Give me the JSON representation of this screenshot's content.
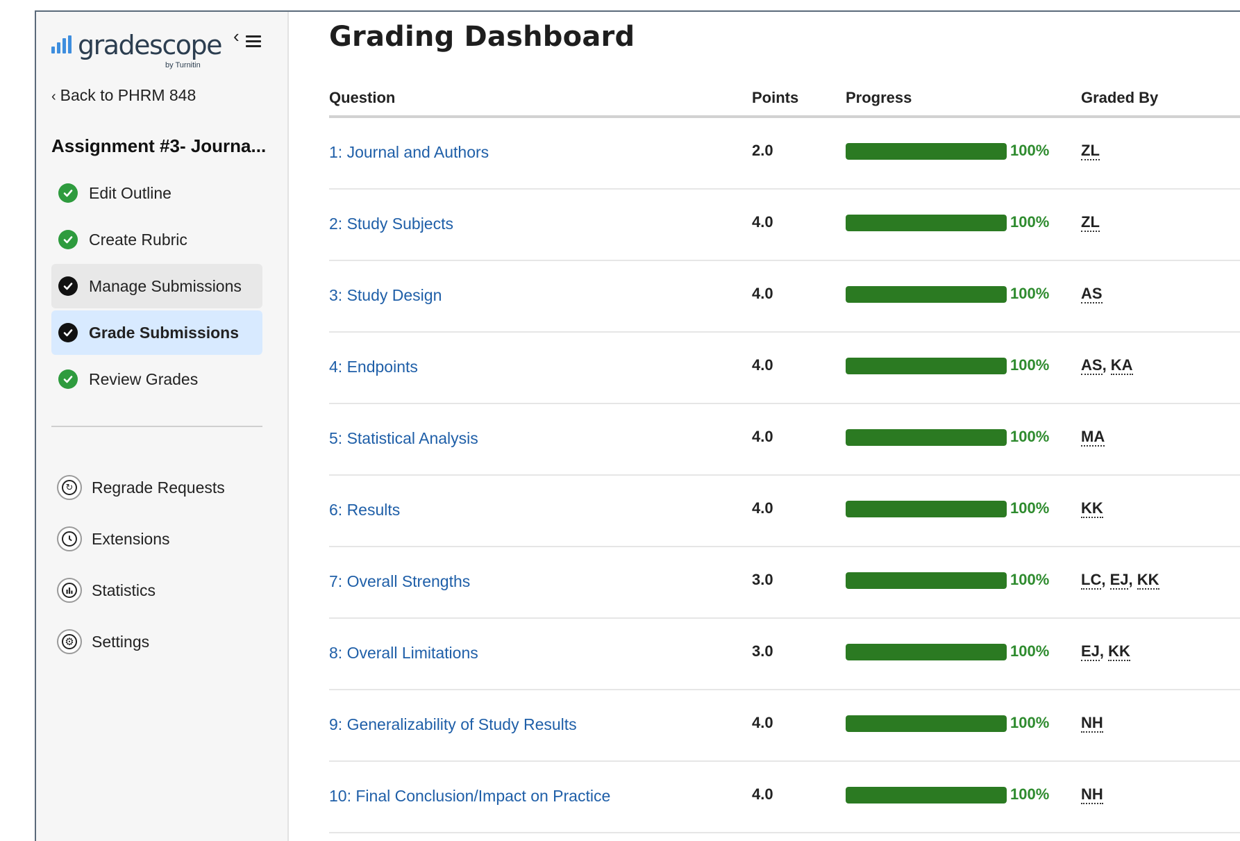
{
  "brand": {
    "name": "gradescope",
    "byline": "by Turnitin",
    "accent_color": "#3e8ede"
  },
  "sidebar": {
    "back_label": "Back to PHRM 848",
    "assignment_title": "Assignment #3- Journa...",
    "workflow": [
      {
        "label": "Edit Outline",
        "status": "complete",
        "icon": "check-circle-green-icon"
      },
      {
        "label": "Create Rubric",
        "status": "complete",
        "icon": "check-circle-green-icon"
      },
      {
        "label": "Manage Submissions",
        "status": "complete",
        "icon": "check-circle-black-icon"
      },
      {
        "label": "Grade Submissions",
        "status": "active",
        "icon": "check-circle-black-icon"
      },
      {
        "label": "Review Grades",
        "status": "complete",
        "icon": "check-circle-green-icon"
      }
    ],
    "tools": [
      {
        "label": "Regrade Requests",
        "icon": "regrade-icon"
      },
      {
        "label": "Extensions",
        "icon": "clock-icon"
      },
      {
        "label": "Statistics",
        "icon": "bar-chart-icon"
      },
      {
        "label": "Settings",
        "icon": "gear-icon"
      }
    ]
  },
  "main": {
    "title": "Grading Dashboard",
    "columns": {
      "question": "Question",
      "points": "Points",
      "progress": "Progress",
      "graded_by": "Graded By"
    },
    "progress_color": "#2b7a22",
    "rows": [
      {
        "question": "1: Journal and Authors",
        "points": "2.0",
        "progress": 100,
        "progress_label": "100%",
        "graders": [
          "ZL"
        ]
      },
      {
        "question": "2: Study Subjects",
        "points": "4.0",
        "progress": 100,
        "progress_label": "100%",
        "graders": [
          "ZL"
        ]
      },
      {
        "question": "3: Study Design",
        "points": "4.0",
        "progress": 100,
        "progress_label": "100%",
        "graders": [
          "AS"
        ]
      },
      {
        "question": "4: Endpoints",
        "points": "4.0",
        "progress": 100,
        "progress_label": "100%",
        "graders": [
          "AS",
          "KA"
        ]
      },
      {
        "question": "5: Statistical Analysis",
        "points": "4.0",
        "progress": 100,
        "progress_label": "100%",
        "graders": [
          "MA"
        ]
      },
      {
        "question": "6: Results",
        "points": "4.0",
        "progress": 100,
        "progress_label": "100%",
        "graders": [
          "KK"
        ]
      },
      {
        "question": "7: Overall Strengths",
        "points": "3.0",
        "progress": 100,
        "progress_label": "100%",
        "graders": [
          "LC",
          "EJ",
          "KK"
        ]
      },
      {
        "question": "8: Overall Limitations",
        "points": "3.0",
        "progress": 100,
        "progress_label": "100%",
        "graders": [
          "EJ",
          "KK"
        ]
      },
      {
        "question": "9: Generalizability of Study Results",
        "points": "4.0",
        "progress": 100,
        "progress_label": "100%",
        "graders": [
          "NH"
        ]
      },
      {
        "question": "10: Final Conclusion/Impact on Practice",
        "points": "4.0",
        "progress": 100,
        "progress_label": "100%",
        "graders": [
          "NH"
        ]
      }
    ]
  }
}
